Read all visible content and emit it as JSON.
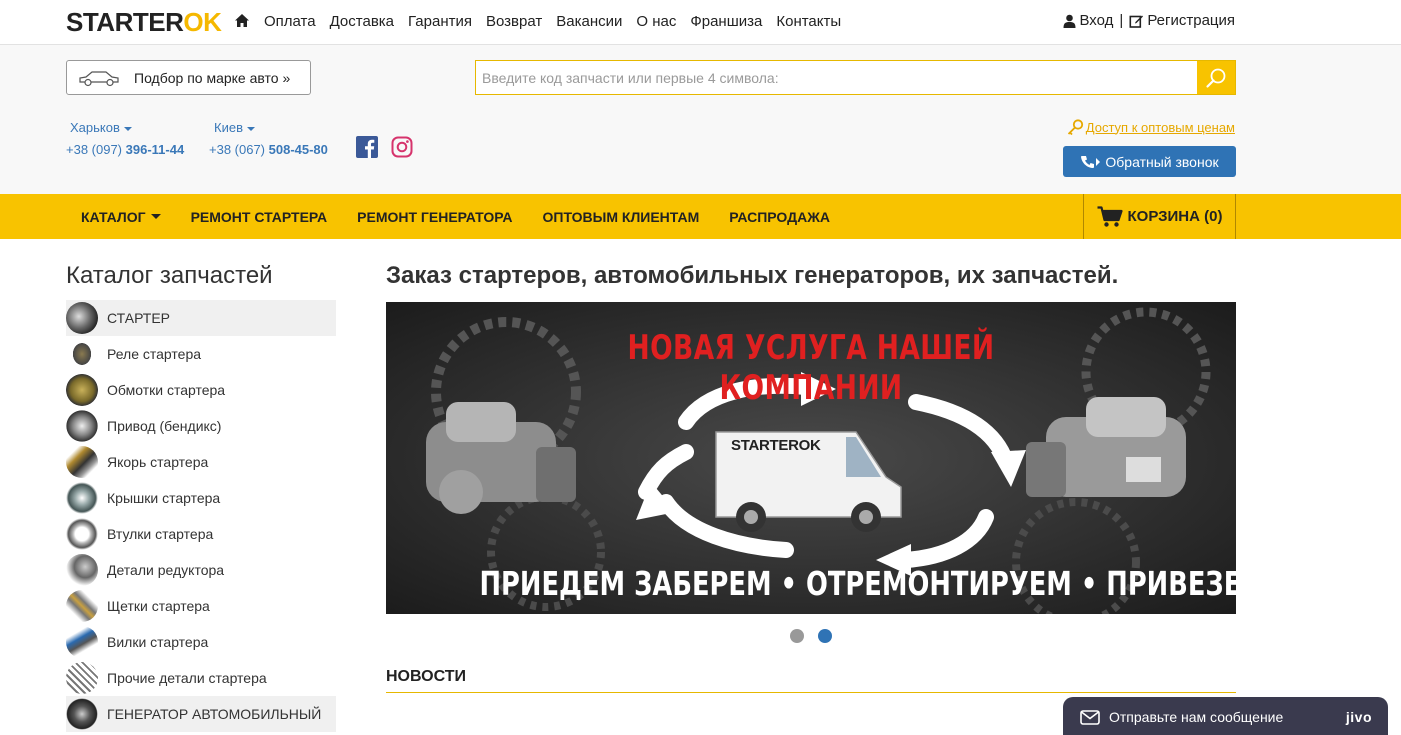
{
  "logo": {
    "text_a": "STARTER",
    "text_b": "OK"
  },
  "topnav": {
    "items": [
      "Оплата",
      "Доставка",
      "Гарантия",
      "Возврат",
      "Вакансии",
      "О нас",
      "Франшиза",
      "Контакты"
    ]
  },
  "auth": {
    "login": "Вход",
    "separator": "|",
    "register": "Регистрация"
  },
  "header": {
    "brand_button": "Подбор по марке авто »",
    "search_placeholder": "Введите код запчасти или первые 4 символа:",
    "cities": [
      {
        "name": "Харьков",
        "phone_prefix": "+38 (097) ",
        "phone_main": "396-11-44"
      },
      {
        "name": "Киев",
        "phone_prefix": "+38 (067) ",
        "phone_main": "508-45-80"
      }
    ],
    "wholesale_link": "Доступ к оптовым ценам",
    "callback_button": "Обратный звонок"
  },
  "mainnav": {
    "items": [
      "КАТАЛОГ",
      "РЕМОНТ СТАРТЕРА",
      "РЕМОНТ ГЕНЕРАТОРА",
      "ОПТОВЫМ КЛИЕНТАМ",
      "РАСПРОДАЖА"
    ],
    "cart": "КОРЗИНА (0)"
  },
  "sidebar": {
    "title": "Каталог запчастей",
    "items": [
      {
        "label": "СТАРТЕР",
        "highlight": true
      },
      {
        "label": "Реле стартера"
      },
      {
        "label": "Обмотки стартера"
      },
      {
        "label": "Привод (бендикс)"
      },
      {
        "label": "Якорь стартера"
      },
      {
        "label": "Крышки стартера"
      },
      {
        "label": "Втулки стартера"
      },
      {
        "label": "Детали редуктора"
      },
      {
        "label": "Щетки стартера"
      },
      {
        "label": "Вилки стартера"
      },
      {
        "label": "Прочие детали стартера"
      },
      {
        "label": "ГЕНЕРАТОР АВТОМОБИЛЬНЫЙ",
        "highlight": true
      }
    ]
  },
  "main": {
    "title": "Заказ стартеров, автомобильных генераторов, их запчастей.",
    "banner": {
      "headline": "НОВАЯ УСЛУГА НАШЕЙ КОМПАНИИ",
      "footer": "ПРИЕДЕМ ЗАБЕРЕМ • ОТРЕМОНТИРУЕМ • ПРИВЕЗЕМ ОБРАТНО",
      "van_logo": "STARTEROK"
    },
    "slider_active": 2,
    "news_heading": "НОВОСТИ"
  },
  "chat": {
    "label": "Отправьте нам сообщение",
    "brand": "jivo"
  },
  "colors": {
    "accent": "#f8c300",
    "link": "#3a78b8",
    "button": "#2f73b5"
  }
}
